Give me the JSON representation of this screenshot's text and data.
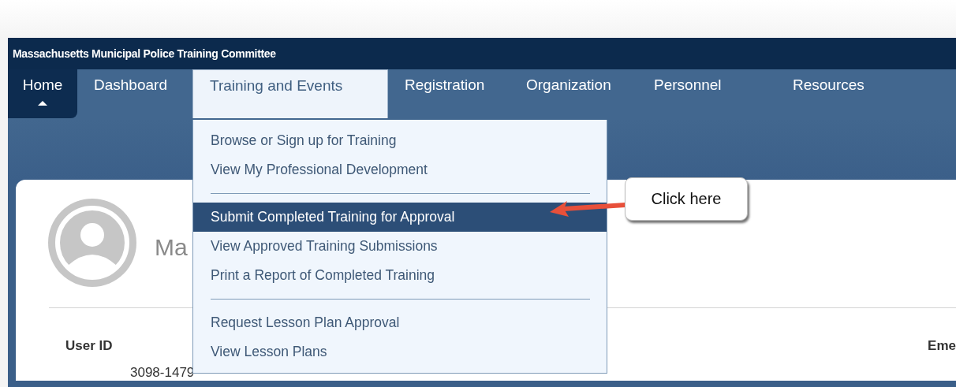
{
  "header": {
    "title": "Massachusetts Municipal Police Training Committee"
  },
  "nav": {
    "tabs": [
      {
        "label": "Home",
        "selected": true,
        "expanded": false
      },
      {
        "label": "Dashboard",
        "selected": false,
        "expanded": false
      },
      {
        "label": "Training and Events",
        "selected": false,
        "expanded": true
      },
      {
        "label": "Registration",
        "selected": false,
        "expanded": false
      },
      {
        "label": "Organization",
        "selected": false,
        "expanded": false
      },
      {
        "label": "Personnel",
        "selected": false,
        "expanded": false
      },
      {
        "label": "Resources",
        "selected": false,
        "expanded": false
      }
    ]
  },
  "dropdown": {
    "sections": [
      {
        "items": [
          {
            "label": "Browse or Sign up for Training",
            "selected": false
          },
          {
            "label": "View My Professional Development",
            "selected": false
          }
        ]
      },
      {
        "items": [
          {
            "label": "Submit Completed Training for Approval",
            "selected": true
          },
          {
            "label": "View Approved Training Submissions",
            "selected": false
          },
          {
            "label": "Print a Report of Completed Training",
            "selected": false
          }
        ]
      },
      {
        "items": [
          {
            "label": "Request Lesson Plan Approval",
            "selected": false
          },
          {
            "label": "View Lesson Plans",
            "selected": false
          }
        ]
      }
    ]
  },
  "profile": {
    "name": "Ma",
    "user_id_label": "User ID",
    "user_id": "3098-1479",
    "column_3": "Eme"
  },
  "callout": {
    "text": "Click here"
  }
}
